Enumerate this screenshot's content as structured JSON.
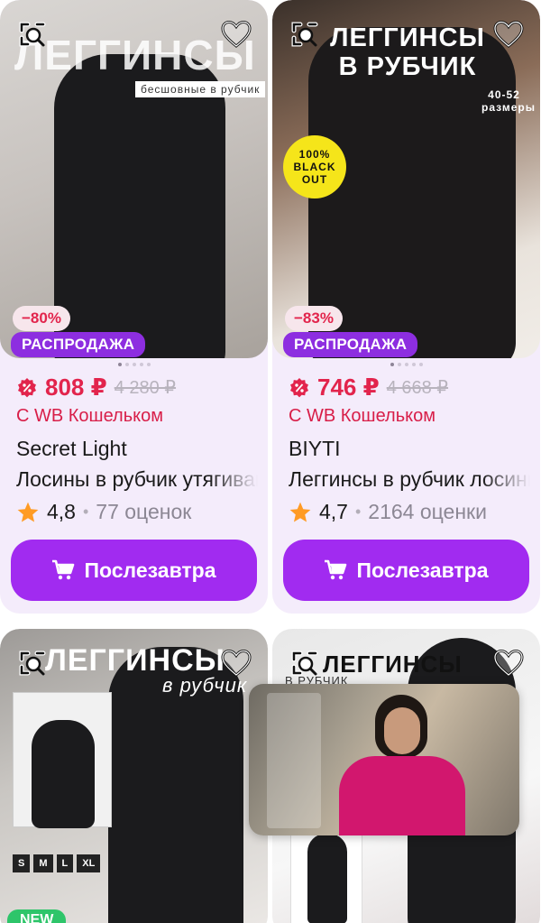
{
  "colors": {
    "accent": "#a12bf0",
    "sale_badge": "#8d2ee0",
    "price": "#e2244c",
    "new_badge": "#2ec56a"
  },
  "products": [
    {
      "banner": "ЛЕГГИНСЫ",
      "banner_sub": "бесшовные в рубчик",
      "discount": "−80%",
      "sale_label": "РАСПРОДАЖА",
      "price": "808 ₽",
      "old_price": "4 280 ₽",
      "wallet": "С WB Кошельком",
      "brand": "Secret Light",
      "name": "Лосины в рубчик утягивающие",
      "rating": "4,8",
      "reviews": "77 оценок",
      "button": "Послезавтра"
    },
    {
      "banner": "ЛЕГГИНСЫ В РУБЧИК",
      "banner_sub": "40-52 размеры",
      "callout": "100% BLACK OUT",
      "discount": "−83%",
      "sale_label": "РАСПРОДАЖА",
      "price": "746 ₽",
      "old_price": "4 668 ₽",
      "wallet": "С WB Кошельком",
      "brand": "BIYTI",
      "name": "Леггинсы в рубчик лосины",
      "rating": "4,7",
      "reviews": "2164 оценки",
      "button": "Послезавтра"
    },
    {
      "banner": "ЛЕГГИНСЫ",
      "banner_sub": "в рубчик",
      "sizes": [
        "S",
        "M",
        "L",
        "XL"
      ],
      "new_label": "NEW"
    },
    {
      "banner": "ЛЕГГИНСЫ",
      "banner_sub": "В РУБЧИК"
    }
  ],
  "icons": {
    "similar": "similar-search-icon",
    "favorite": "heart-icon",
    "star": "star-icon",
    "cart": "cart-icon",
    "discount": "percent-tag-icon"
  }
}
